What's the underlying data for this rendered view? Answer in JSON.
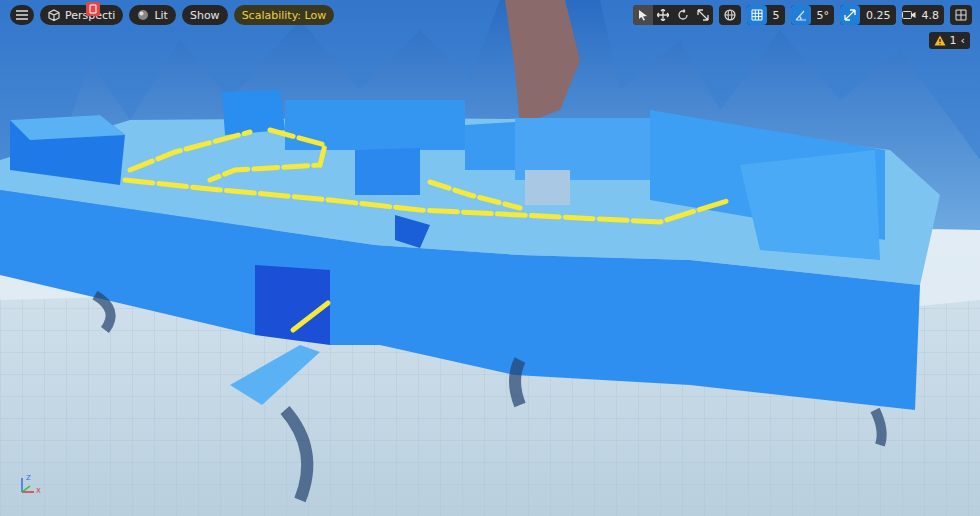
{
  "view_buttons": [
    {
      "label": "Perspecti",
      "kind": "perspective"
    },
    {
      "label": "Lit",
      "kind": "lit"
    },
    {
      "label": "Show",
      "kind": "plain"
    }
  ],
  "scalability": {
    "label": "Scalability: Low"
  },
  "transform_tools": [
    {
      "kind": "select",
      "selected": true
    },
    {
      "kind": "translate",
      "selected": false
    },
    {
      "kind": "rotate",
      "selected": false
    },
    {
      "kind": "scale",
      "selected": false
    }
  ],
  "snap_settings": [
    {
      "kind": "grid",
      "value": "5",
      "on": true
    },
    {
      "kind": "angle",
      "value": "5°",
      "on": true
    },
    {
      "kind": "scale",
      "value": "0.25",
      "on": true
    }
  ],
  "camera_speed": {
    "value": "4.8"
  },
  "warnings": {
    "count": "1",
    "arrow": "‹"
  },
  "axis_gizmo": {
    "labels": [
      "Z",
      "X"
    ]
  }
}
